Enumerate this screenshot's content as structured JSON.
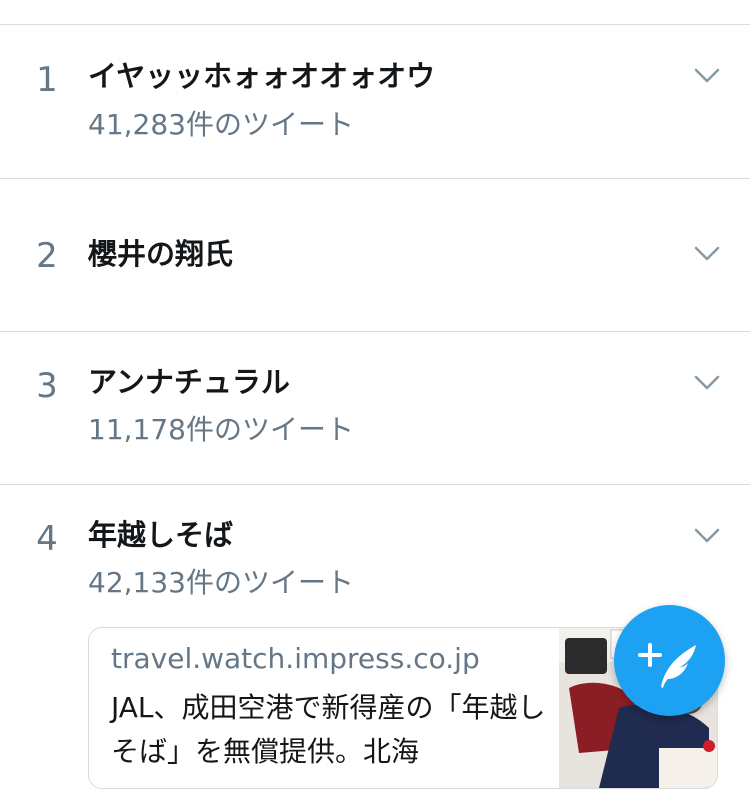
{
  "trends": [
    {
      "rank": "1",
      "title": "イヤッッホォォオオォオウ",
      "count": "41,283件のツイート"
    },
    {
      "rank": "2",
      "title": "櫻井の翔氏",
      "count": ""
    },
    {
      "rank": "3",
      "title": "アンナチュラル",
      "count": "11,178件のツイート"
    },
    {
      "rank": "4",
      "title": "年越しそば",
      "count": "42,133件のツイート"
    }
  ],
  "link_card": {
    "domain": "travel.watch.impress.co.jp",
    "text": "JAL、成田空港で新得産の「年越しそば」を無償提供。北海"
  },
  "icons": {
    "trend_menu": "chevron-down-icon",
    "compose": "compose-tweet-icon"
  },
  "colors": {
    "accent": "#1da1f2",
    "secondary_text": "#657786",
    "divider": "#d8dde2"
  }
}
